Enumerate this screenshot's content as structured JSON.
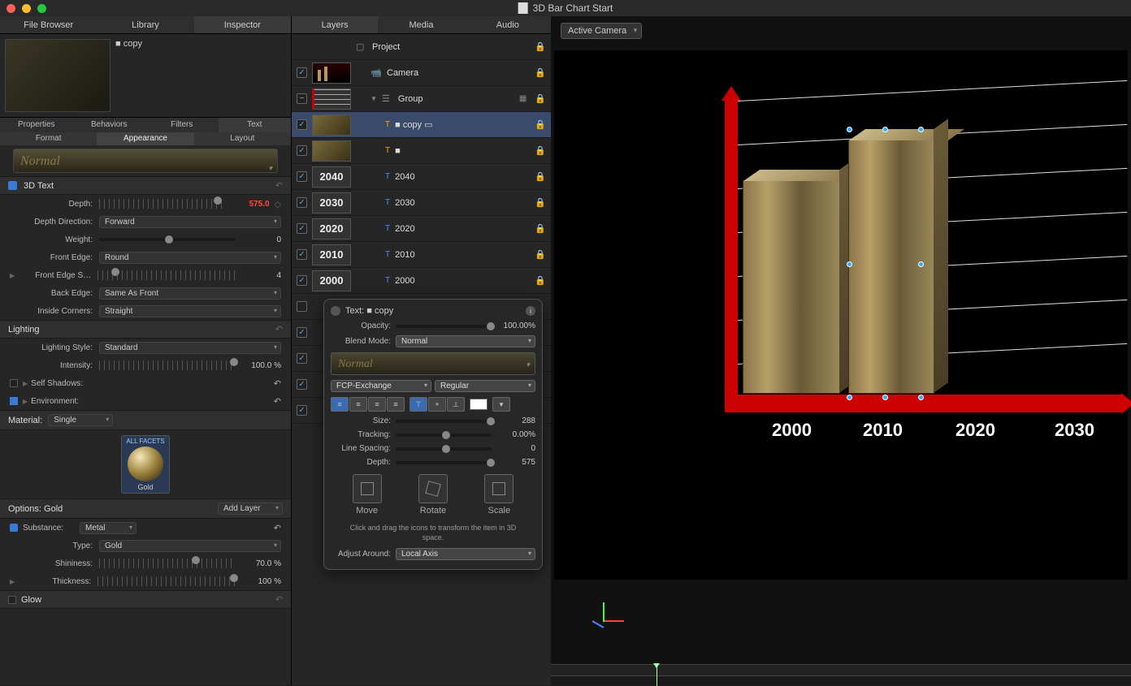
{
  "window": {
    "title": "3D Bar Chart Start"
  },
  "leftTabs": {
    "fileBrowser": "File Browser",
    "library": "Library",
    "inspector": "Inspector"
  },
  "preview": {
    "name": "copy"
  },
  "inspTabs": {
    "properties": "Properties",
    "behaviors": "Behaviors",
    "filters": "Filters",
    "text": "Text"
  },
  "textSubTabs": {
    "format": "Format",
    "appearance": "Appearance",
    "layout": "Layout"
  },
  "stylePreview": "Normal",
  "section3d": {
    "title": "3D Text",
    "depth": {
      "label": "Depth:",
      "value": "575.0"
    },
    "depthDirection": {
      "label": "Depth Direction:",
      "value": "Forward"
    },
    "weight": {
      "label": "Weight:",
      "value": "0"
    },
    "frontEdge": {
      "label": "Front Edge:",
      "value": "Round"
    },
    "frontEdgeSize": {
      "label": "Front Edge S…",
      "value": "4"
    },
    "backEdge": {
      "label": "Back Edge:",
      "value": "Same As Front"
    },
    "insideCorners": {
      "label": "Inside Corners:",
      "value": "Straight"
    }
  },
  "lighting": {
    "title": "Lighting",
    "style": {
      "label": "Lighting Style:",
      "value": "Standard"
    },
    "intensity": {
      "label": "Intensity:",
      "value": "100.0",
      "unit": "%"
    },
    "selfShadows": {
      "label": "Self Shadows:"
    },
    "environment": {
      "label": "Environment:"
    }
  },
  "material": {
    "label": "Material:",
    "value": "Single",
    "facets": "ALL FACETS",
    "name": "Gold"
  },
  "options": {
    "title": "Options: Gold",
    "addLayer": "Add Layer",
    "substance": {
      "label": "Substance:",
      "value": "Metal"
    },
    "type": {
      "label": "Type:",
      "value": "Gold"
    },
    "shininess": {
      "label": "Shininess:",
      "value": "70.0",
      "unit": "%"
    },
    "thickness": {
      "label": "Thickness:",
      "value": "100",
      "unit": "%"
    }
  },
  "glow": {
    "title": "Glow"
  },
  "midTabs": {
    "layers": "Layers",
    "media": "Media",
    "audio": "Audio"
  },
  "layers": {
    "project": "Project",
    "camera": "Camera",
    "group": "Group",
    "copy": "copy",
    "y2040": "2040",
    "y2030": "2030",
    "y2020": "2020",
    "y2010": "2010",
    "y2000": "2000"
  },
  "viewport": {
    "camera": "Active Camera"
  },
  "hud": {
    "title": "Text: ■ copy",
    "opacity": {
      "label": "Opacity:",
      "value": "100.00%"
    },
    "blendMode": {
      "label": "Blend Mode:",
      "value": "Normal"
    },
    "preview": "Normal",
    "font": "FCP-Exchange",
    "weight": "Regular",
    "size": {
      "label": "Size:",
      "value": "288"
    },
    "tracking": {
      "label": "Tracking:",
      "value": "0.00%"
    },
    "lineSpacing": {
      "label": "Line Spacing:",
      "value": "0"
    },
    "depth": {
      "label": "Depth:",
      "value": "575"
    },
    "move": "Move",
    "rotate": "Rotate",
    "scale": "Scale",
    "help": "Click and drag the icons to transform the item in 3D space.",
    "adjustAround": {
      "label": "Adjust Around:",
      "value": "Local Axis"
    }
  },
  "xlabels": {
    "l2000": "2000",
    "l2010": "2010",
    "l2020": "2020",
    "l2030": "2030"
  }
}
